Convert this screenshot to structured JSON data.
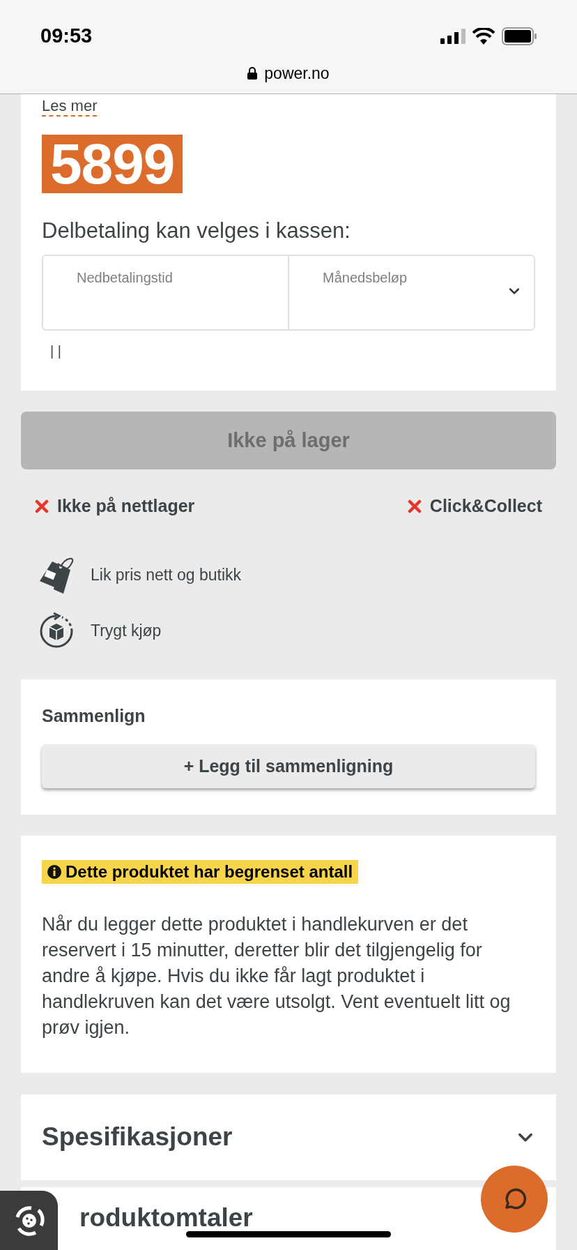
{
  "status_bar": {
    "time": "09:53"
  },
  "address_bar": {
    "url": "power.no"
  },
  "price_card": {
    "read_more": "Les mer",
    "price": "5899",
    "installment_heading": "Delbetaling kan velges i kassen:",
    "fields": [
      {
        "label": "Nedbetalingstid",
        "kind": "text"
      },
      {
        "label": "Månedsbeløp",
        "kind": "dropdown"
      }
    ],
    "note": "| |"
  },
  "stock_button": {
    "label": "Ikke på lager",
    "disabled": true
  },
  "availability": [
    {
      "label": "Ikke på nettlager",
      "available": false
    },
    {
      "label": "Click&Collect",
      "available": false
    }
  ],
  "features": [
    {
      "kind": "price-tag",
      "label": "Lik pris nett og butikk"
    },
    {
      "kind": "secure",
      "label": "Trygt kjøp"
    }
  ],
  "compare": {
    "heading": "Sammenlign",
    "button": "+ Legg til sammenligning"
  },
  "notice": {
    "badge": "Dette produktet har begrenset antall",
    "text": "Når du legger dette produktet i handlekurven er det reservert i 15 minutter, deretter blir det tilgjengelig for andre å kjøpe. Hvis du ikke får lagt produktet i handlekruven kan det være utsolgt. Vent eventuelt litt og prøv igjen."
  },
  "sections": [
    {
      "title": "Spesifikasjoner",
      "expanded": false
    },
    {
      "title": "roduktomtaler"
    }
  ]
}
